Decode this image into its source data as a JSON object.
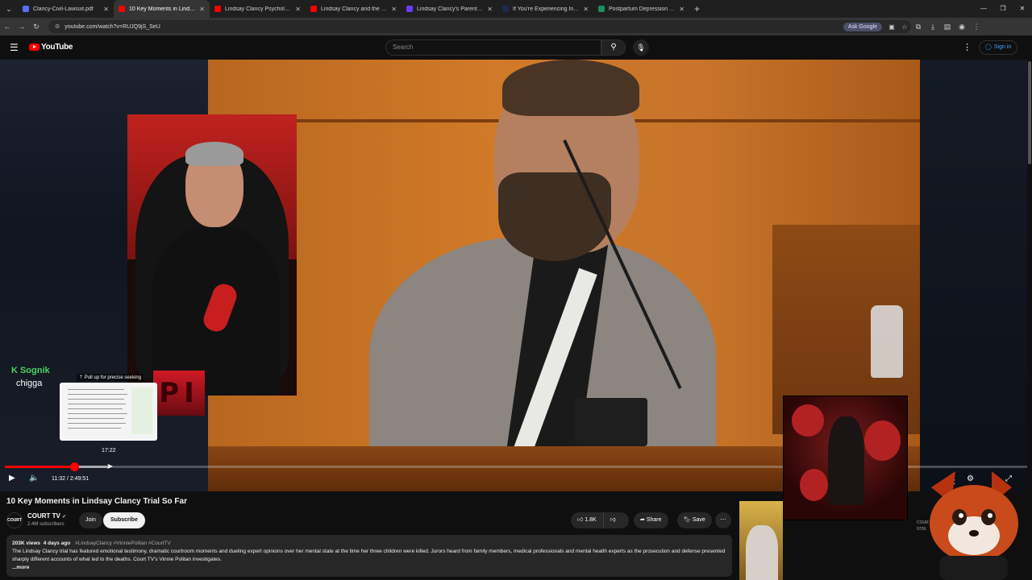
{
  "browser": {
    "tabs": [
      {
        "title": "Clancy-Civil-Lawsuit.pdf",
        "color": "#5a6cff"
      },
      {
        "title": "10 Key Moments in Lindsay Cla",
        "color": "#ff0000"
      },
      {
        "title": "Lindsay Clancy Psychologist Dr",
        "color": "#ff0000"
      },
      {
        "title": "Lindsay Clancy and the Eviden",
        "color": "#ff0000"
      },
      {
        "title": "Lindsay Clancy's Parents' $1 M",
        "color": "#6a3cff"
      },
      {
        "title": "If You're Experiencing Intrusiv",
        "color": "#1b2a4e"
      },
      {
        "title": "Postpartum Depression (PPD)",
        "color": "#1d8f5f"
      }
    ],
    "url": "youtube.com/watch?v=RUJQ9jS_SeU",
    "ask_google": "Ask Google"
  },
  "youtube": {
    "logo_text": "YouTube",
    "search_placeholder": "Search",
    "sign_in": "Sign in"
  },
  "player": {
    "overlay_brand": "Sognik",
    "overlay_sub": "chigga",
    "pull_up_hint": "Pull up for precise seeking",
    "preview_time": "17:22",
    "time_display": "11:32 / 2:49:51",
    "played_fraction": 0.068,
    "pi_sign": "PI"
  },
  "video": {
    "title": "10 Key Moments in Lindsay Clancy Trial So Far",
    "channel": "COURT TV",
    "channel_avatar": "COURT",
    "subscribers": "2.4M subscribers",
    "join": "Join",
    "subscribe": "Subscribe",
    "likes": "1.8K",
    "share": "Share",
    "save": "Save",
    "views": "203K views",
    "age": "4 days ago",
    "hashtags": "#LindsayClancy #VinniePolitan #CourtTV",
    "description": "The Lindsay Clancy trial has featured emotional testimony, dramatic courtroom moments and dueling expert opinions over her mental state at the time her three children were killed. Jurors heard from family members, medical professionals and mental health experts as the prosecution and defense presented sharply different accounts of what led to the deaths. Court TV's Vinnie Politan investigates.",
    "more": "...more"
  },
  "sidebar": {
    "next_channel": "COUR",
    "next_views": "972K"
  }
}
